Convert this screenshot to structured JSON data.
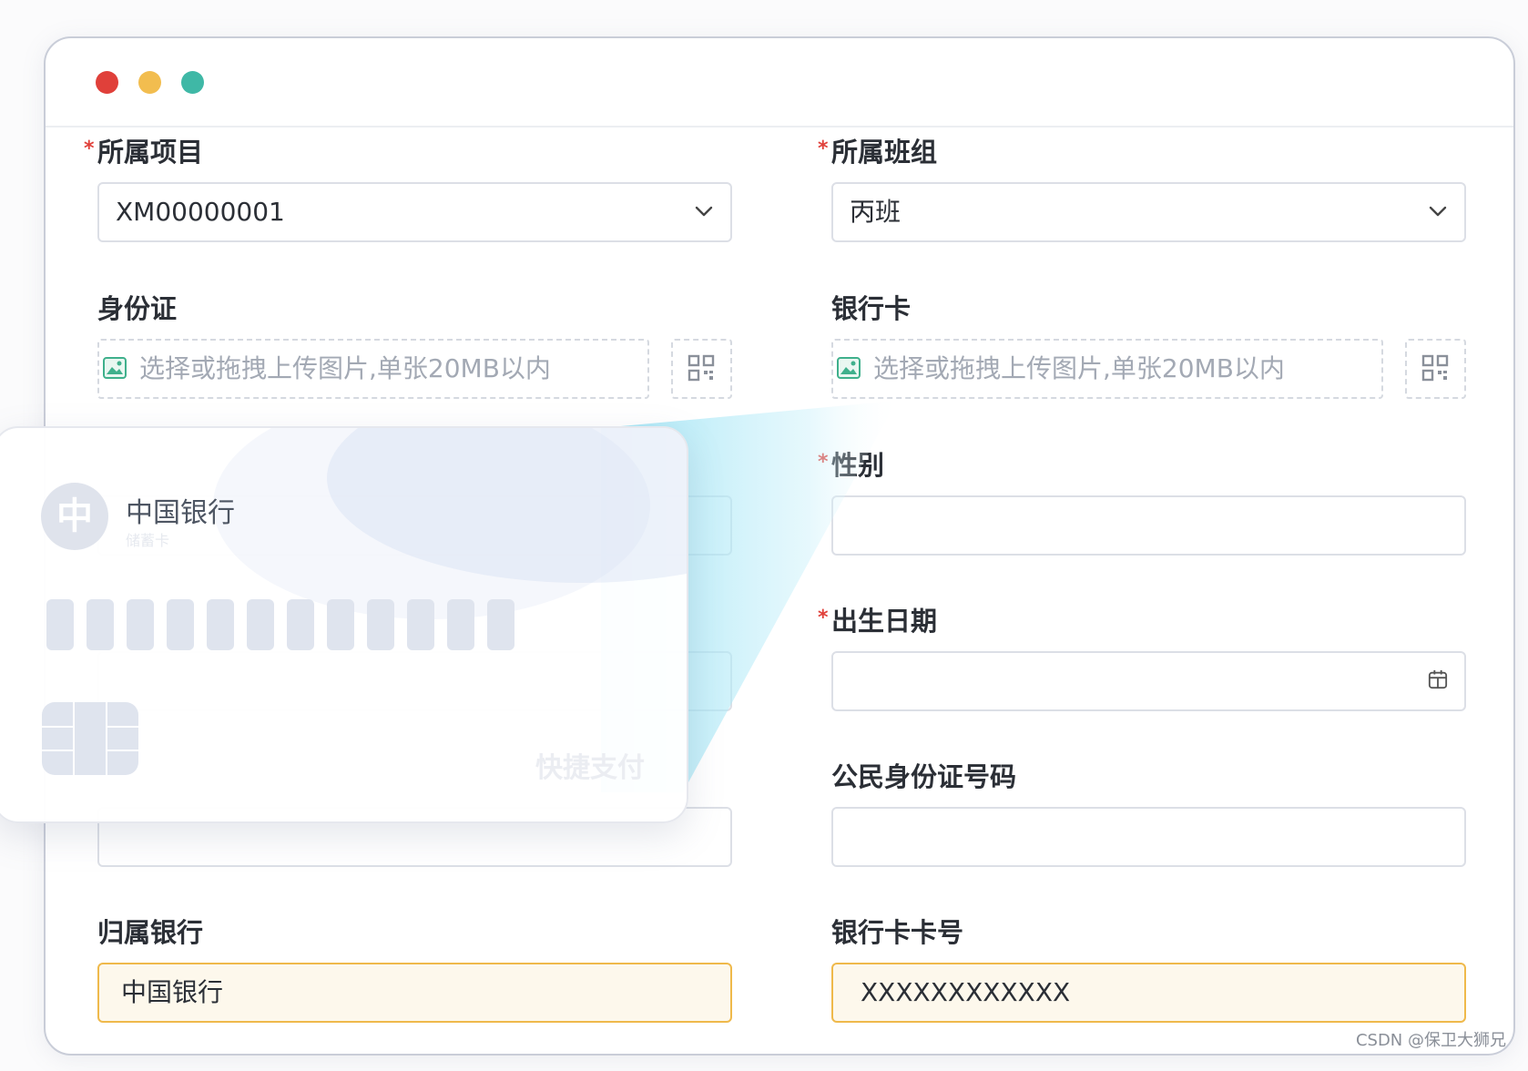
{
  "window": {
    "controls": [
      "close",
      "minimize",
      "maximize"
    ]
  },
  "form": {
    "project": {
      "label": "所属项目",
      "value": "XM00000001"
    },
    "team": {
      "label": "所属班组",
      "value": "丙班"
    },
    "id_card": {
      "label": "身份证",
      "upload_text": "选择或拖拽上传图片,单张20MB以内"
    },
    "bank_card": {
      "label": "银行卡",
      "upload_text": "选择或拖拽上传图片,单张20MB以内"
    },
    "gender": {
      "label": "性别",
      "value": ""
    },
    "birth_date": {
      "label": "出生日期",
      "value": ""
    },
    "citizen_id": {
      "label": "公民身份证号码",
      "value": ""
    },
    "bank": {
      "label": "归属银行",
      "value": "中国银行"
    },
    "bank_card_no": {
      "label": "银行卡卡号",
      "value": "XXXXXXXXXXXX"
    },
    "required_mark": "*"
  },
  "card": {
    "logo_char": "中",
    "bank_name": "中国银行",
    "card_type": "储蓄卡",
    "quick_pay": "快捷支付",
    "digit_count": 12
  },
  "watermark": "CSDN @保卫大狮兄",
  "colors": {
    "required": "#e0403a",
    "highlight_border": "#efb94b",
    "highlight_bg": "#fdf8ec",
    "beam": "#7fd8ef"
  }
}
